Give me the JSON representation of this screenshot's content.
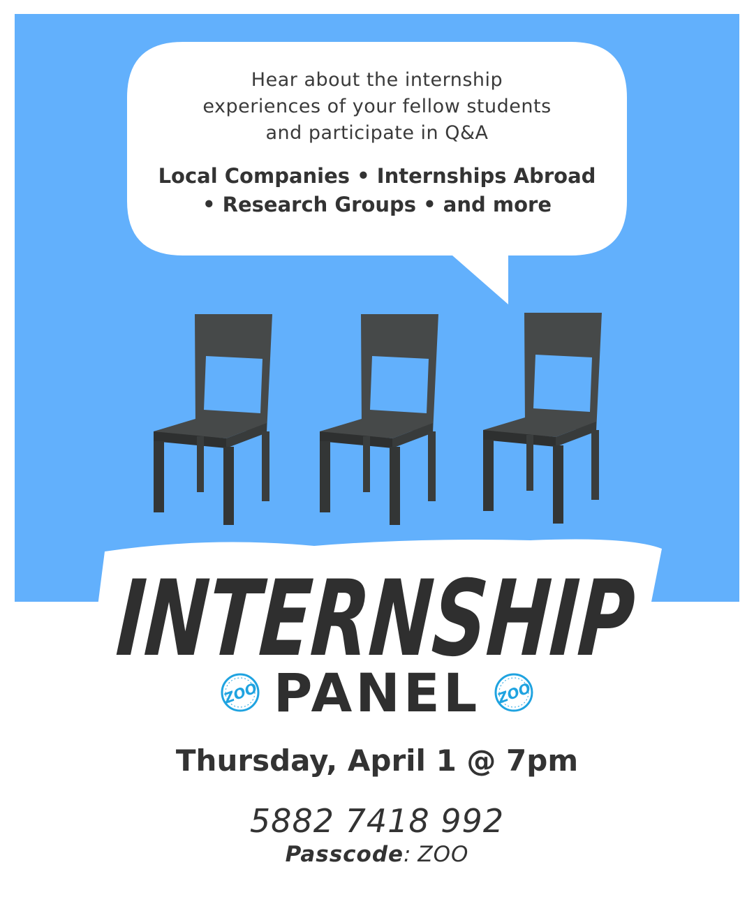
{
  "bubble": {
    "intro": [
      "Hear about the internship",
      "experiences of your fellow students",
      "and participate in Q&A"
    ],
    "topics": [
      "Local Companies • Internships Abroad",
      "• Research Groups • and more"
    ]
  },
  "title": {
    "main": "INTERNSHIP",
    "sub": "PANEL"
  },
  "event": {
    "date": "Thursday, April 1 @ 7pm",
    "meeting_id": "5882 7418 992",
    "passcode_label": "Passcode",
    "passcode_sep": ":",
    "passcode_value": "ZOO"
  },
  "badge": {
    "text": "ZOO",
    "icon": "zoo-logo-icon"
  },
  "colors": {
    "background_blue": "#62b0fc",
    "chair_dark": "#3f4242",
    "text_dark": "#2f2f2f",
    "badge_blue": "#1fa3e0"
  }
}
